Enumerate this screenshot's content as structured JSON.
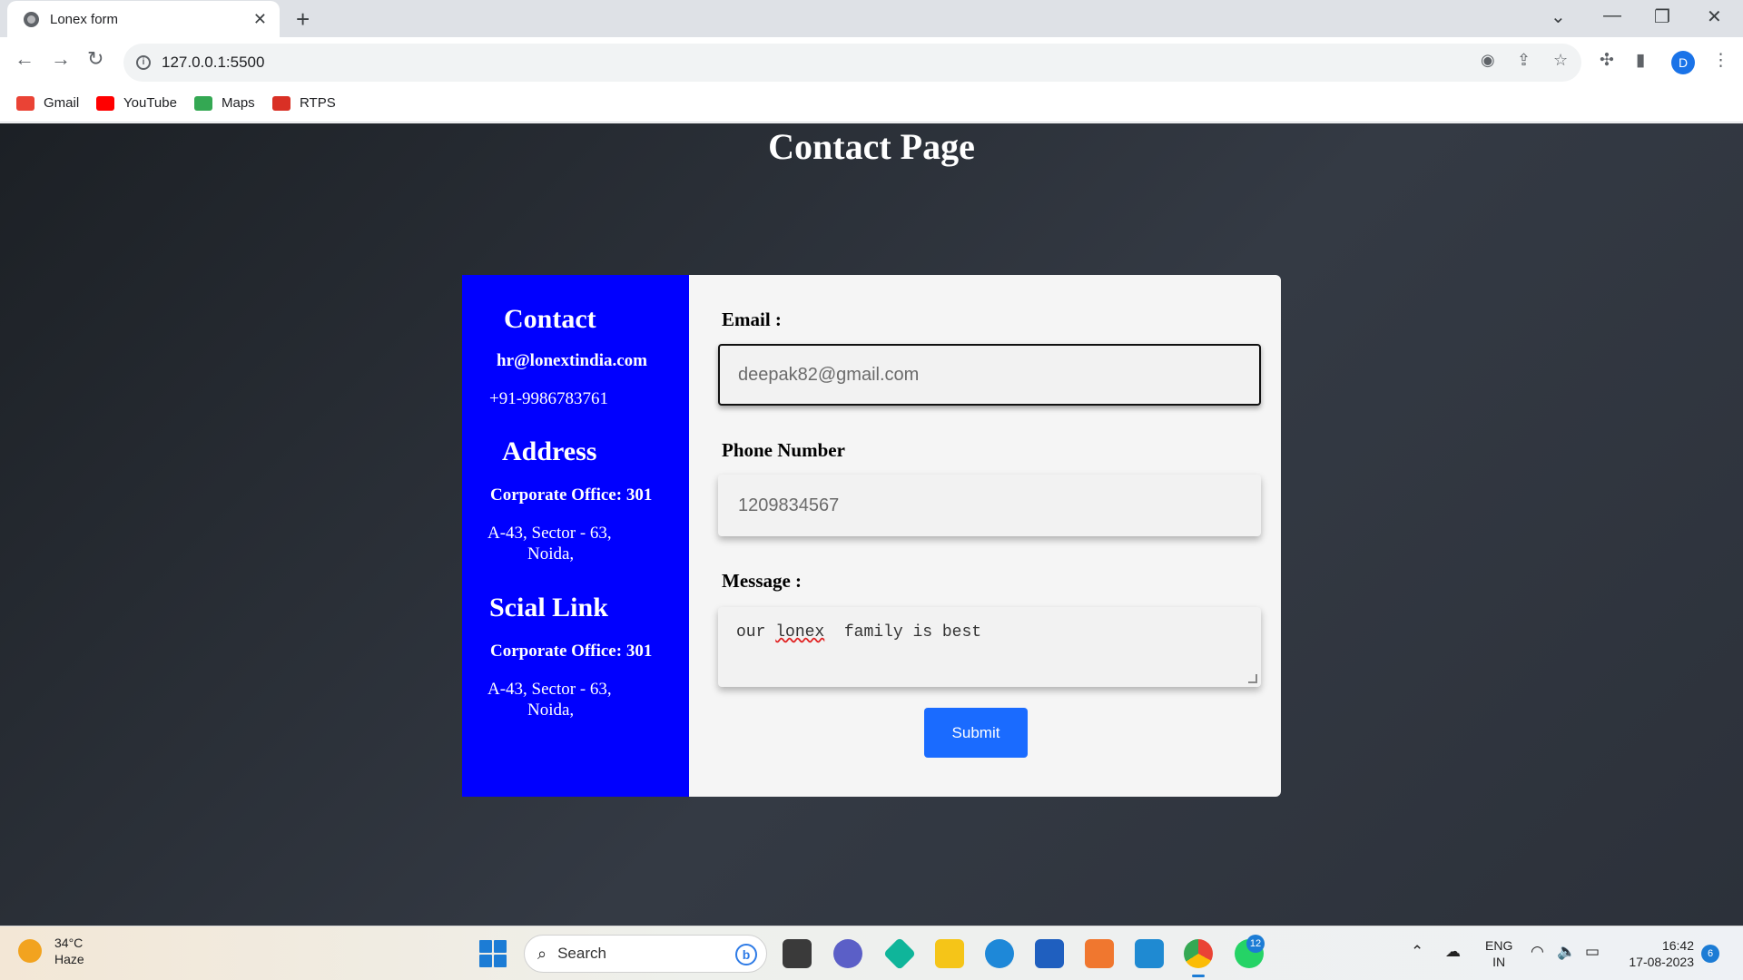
{
  "browser": {
    "tab_title": "Lonex form",
    "url": "127.0.0.1:5500",
    "profile_initial": "D",
    "bookmarks": [
      {
        "label": "Gmail",
        "icon": "gmail-icon",
        "color": "#ea4335"
      },
      {
        "label": "YouTube",
        "icon": "youtube-icon",
        "color": "#ff0000"
      },
      {
        "label": "Maps",
        "icon": "maps-icon",
        "color": "#34a853"
      },
      {
        "label": "RTPS",
        "icon": "rtps-icon",
        "color": "#d93025"
      }
    ]
  },
  "page": {
    "title": "Contact Page"
  },
  "sidebar": {
    "contact_heading": "Contact",
    "email": "hr@lonextindia.com",
    "phone": "+91-9986783761",
    "address_heading": "Address",
    "address_office": "Corporate Office: 301",
    "address_line1": "A-43, Sector - 63,",
    "address_line2": "Noida,",
    "social_heading": "Scial Link",
    "social_office": "Corporate Office: 301",
    "social_line1": "A-43, Sector - 63,",
    "social_line2": "Noida,"
  },
  "form": {
    "email_label": "Email :",
    "email_value": "deepak82@gmail.com",
    "phone_label": "Phone Number",
    "phone_value": "1209834567",
    "message_label": "Message :",
    "message_word1": "our",
    "message_word2": "lonex",
    "message_rest": "family is best",
    "submit_label": "Submit"
  },
  "taskbar": {
    "temperature": "34°C",
    "weather": "Haze",
    "search_placeholder": "Search",
    "whatsapp_badge": "12",
    "lang_top": "ENG",
    "lang_bottom": "IN",
    "time": "16:42",
    "date": "17-08-2023",
    "notifications": "6"
  },
  "colors": {
    "sidebar_bg": "#0000ff",
    "submit_bg": "#1a6bff",
    "page_bg": "#2c313a"
  }
}
